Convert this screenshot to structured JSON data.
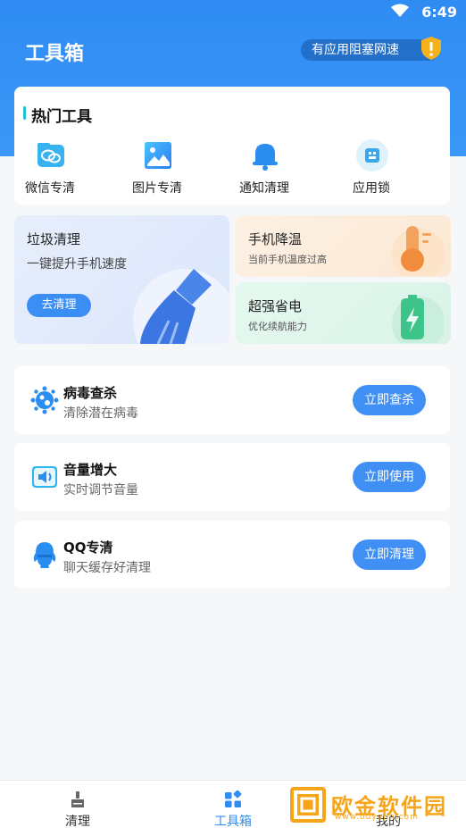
{
  "status_bar": {
    "time": "6:49"
  },
  "header": {
    "title": "工具箱",
    "speed_notice": "有应用阻塞网速"
  },
  "hot_tools": {
    "title": "热门工具",
    "items": [
      {
        "label": "微信专清",
        "icon": "wechat-clean-icon"
      },
      {
        "label": "图片专清",
        "icon": "image-clean-icon"
      },
      {
        "label": "通知清理",
        "icon": "bell-icon"
      },
      {
        "label": "应用锁",
        "icon": "app-lock-icon"
      }
    ]
  },
  "junk_clean": {
    "title": "垃圾清理",
    "subtitle": "一键提升手机速度",
    "button": "去清理"
  },
  "cooling": {
    "title": "手机降温",
    "subtitle": "当前手机温度过高"
  },
  "power_saving": {
    "title": "超强省电",
    "subtitle": "优化续航能力"
  },
  "features": [
    {
      "title": "病毒查杀",
      "subtitle": "清除潜在病毒",
      "button": "立即查杀",
      "icon": "virus-icon"
    },
    {
      "title": "音量增大",
      "subtitle": "实时调节音量",
      "button": "立即使用",
      "icon": "speaker-icon"
    },
    {
      "title": "QQ专清",
      "subtitle": "聊天缓存好清理",
      "button": "立即清理",
      "icon": "qq-icon"
    }
  ],
  "tabbar": {
    "tabs": [
      {
        "label": "清理",
        "active": false
      },
      {
        "label": "工具箱",
        "active": true
      },
      {
        "label": "我的",
        "active": false
      }
    ]
  },
  "watermark": {
    "text": "欧金软件园",
    "url": "www.ouyajin.com"
  },
  "colors": {
    "primary": "#2f8cf3",
    "button": "#3f8ff5",
    "accent_bar": "#22c1d8",
    "warning": "#f6b21b"
  }
}
